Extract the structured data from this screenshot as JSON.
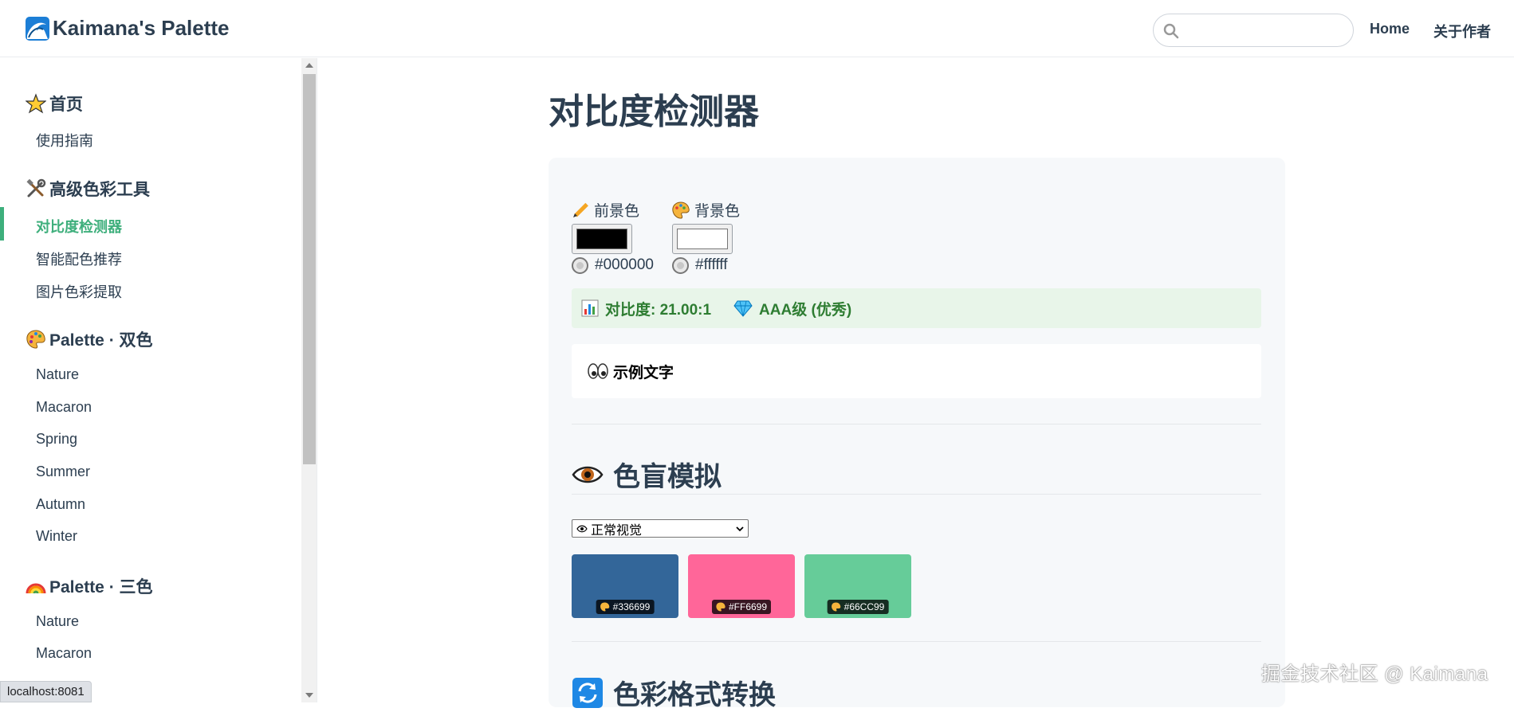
{
  "header": {
    "brand": "Kaimana's Palette",
    "search_placeholder": "",
    "nav": [
      "Home",
      "关于作者"
    ]
  },
  "sidebar": {
    "groups": [
      {
        "title": "首页",
        "items": [
          "使用指南"
        ]
      },
      {
        "title": "高级色彩工具",
        "items": [
          "对比度检测器",
          "智能配色推荐",
          "图片色彩提取"
        ]
      },
      {
        "title": "Palette · 双色",
        "items": [
          "Nature",
          "Macaron",
          "Spring",
          "Summer",
          "Autumn",
          "Winter"
        ]
      },
      {
        "title": "Palette · 三色",
        "items": [
          "Nature",
          "Macaron"
        ]
      }
    ],
    "active_item": "对比度检测器"
  },
  "status_bar": {
    "url": "localhost:8081"
  },
  "main": {
    "title": "对比度检测器",
    "foreground": {
      "label": "前景色",
      "value": "#000000",
      "color": "#000000"
    },
    "background": {
      "label": "背景色",
      "value": "#ffffff",
      "color": "#ffffff"
    },
    "contrast": {
      "ratio_text": "对比度: 21.00:1",
      "level_text": "AAA级 (优秀)"
    },
    "sample_text": "示例文字",
    "color_blind": {
      "title": "色盲模拟",
      "select_value": "正常视觉",
      "swatches": [
        {
          "hex": "#336699",
          "label": "#336699"
        },
        {
          "hex": "#FF6699",
          "label": "#FF6699"
        },
        {
          "hex": "#66CC99",
          "label": "#66CC99"
        }
      ]
    },
    "format_section": {
      "title": "色彩格式转换"
    }
  },
  "watermark": "掘金技术社区 @ Kaimana",
  "colors": {
    "accent": "#3eaf7c",
    "text": "#2c3e50",
    "success_bg": "#e8f5e9",
    "success_text": "#2e7d32"
  }
}
